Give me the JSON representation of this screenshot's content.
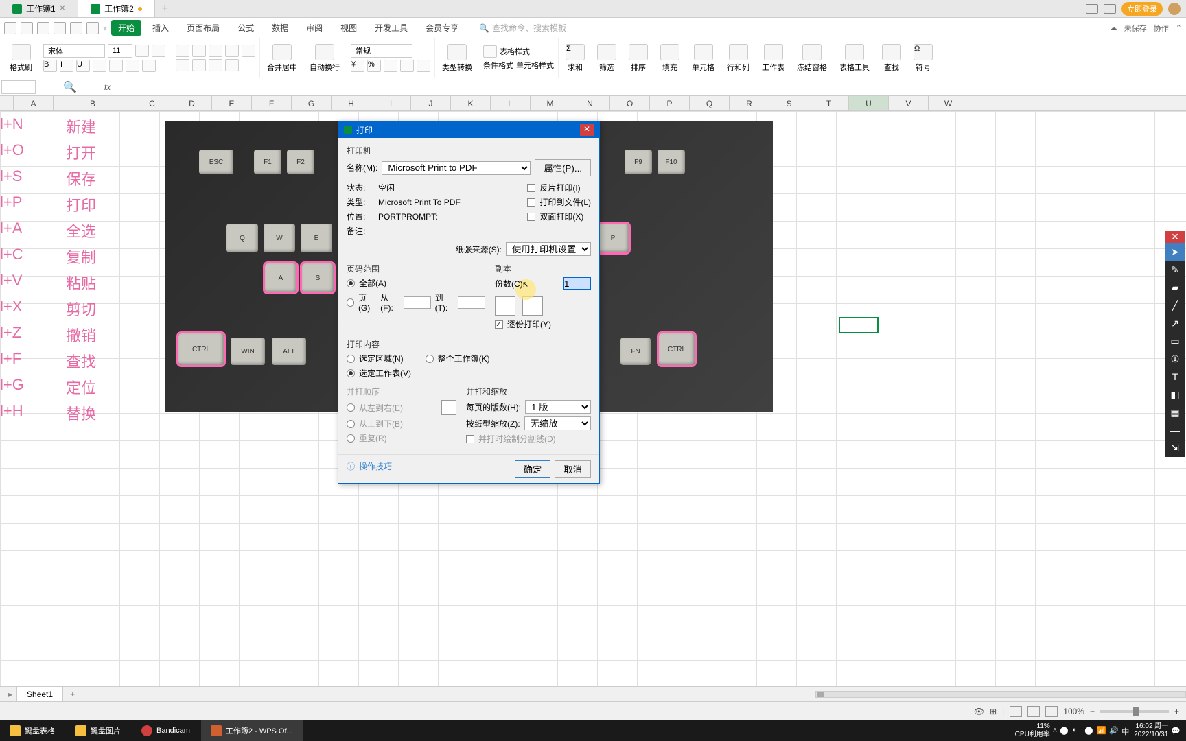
{
  "tabs": {
    "t1": "工作簿1",
    "t2": "工作簿2"
  },
  "login": "立即登录",
  "menu": {
    "start": "开始",
    "insert": "插入",
    "layout": "页面布局",
    "formula": "公式",
    "data": "数据",
    "review": "审阅",
    "view": "视图",
    "dev": "开发工具",
    "member": "会员专享",
    "search_ph": "查找命令、搜索模板"
  },
  "topright": {
    "unsaved": "未保存",
    "collab": "协作"
  },
  "ribbon": {
    "paste": "格式刷",
    "font": "宋体",
    "size": "11",
    "merge": "合并居中",
    "wrap": "自动换行",
    "numfmt": "常规",
    "type": "类型转换",
    "cond": "条件格式",
    "cellstyle": "单元格样式",
    "tablestyle": "表格样式",
    "sum": "求和",
    "filter": "筛选",
    "sort": "排序",
    "fill": "填充",
    "cell": "单元格",
    "rowcol": "行和列",
    "sheet": "工作表",
    "freeze": "冻结窗格",
    "tabletool": "表格工具",
    "find": "查找",
    "symbol": "符号"
  },
  "cells": {
    "a1": "l+N",
    "b1": "新建",
    "a2": "l+O",
    "b2": "打开",
    "a3": "l+S",
    "b3": "保存",
    "a4": "l+P",
    "b4": "打印",
    "a5": "l+A",
    "b5": "全选",
    "a6": "l+C",
    "b6": "复制",
    "a7": "l+V",
    "b7": "粘贴",
    "a8": "l+X",
    "b8": "剪切",
    "a9": "l+Z",
    "b9": "撤销",
    "a10": "l+F",
    "b10": "查找",
    "a11": "l+G",
    "b11": "定位",
    "a12": "l+H",
    "b12": "替换"
  },
  "cols": [
    "A",
    "B",
    "C",
    "D",
    "E",
    "F",
    "G",
    "H",
    "I",
    "J",
    "K",
    "L",
    "M",
    "N",
    "O",
    "P",
    "Q",
    "R",
    "S",
    "T",
    "U",
    "V",
    "W"
  ],
  "dialog": {
    "title": "打印",
    "printer_sect": "打印机",
    "name": "名称(M):",
    "name_val": "Microsoft Print to PDF",
    "props": "属性(P)...",
    "status": "状态:",
    "status_val": "空闲",
    "type": "类型:",
    "type_val": "Microsoft Print To PDF",
    "loc": "位置:",
    "loc_val": "PORTPROMPT:",
    "remark": "备注:",
    "reverse": "反片打印(I)",
    "tofile": "打印到文件(L)",
    "duplex": "双面打印(X)",
    "source": "纸张来源(S):",
    "source_val": "使用打印机设置",
    "range_sect": "页码范围",
    "all": "全部(A)",
    "page": "页(G)",
    "from": "从(F):",
    "to": "到(T):",
    "copy_sect": "副本",
    "copies": "份数(C):",
    "copies_val": "1",
    "collate": "逐份打印(Y)",
    "content_sect": "打印内容",
    "sel": "选定区域(N)",
    "whole": "整个工作簿(K)",
    "selsheet": "选定工作表(V)",
    "order_sect": "并打顺序",
    "ltr": "从左到右(E)",
    "ttb": "从上到下(B)",
    "repeat": "重复(R)",
    "scale_sect": "并打和缩放",
    "perpage": "每页的版数(H):",
    "perpage_val": "1 版",
    "zoom": "按纸型缩放(Z):",
    "zoom_val": "无缩放",
    "drawline": "并打时绘制分割线(D)",
    "tips": "操作技巧",
    "ok": "确定",
    "cancel": "取消"
  },
  "sheet": "Sheet1",
  "zoom": "100%",
  "taskbar": {
    "i1": "键盘表格",
    "i2": "键盘图片",
    "i3": "Bandicam",
    "i4": "工作簿2 - WPS Of..."
  },
  "tray": {
    "pct": "11%",
    "cpu": "CPU利用率",
    "time": "16:02",
    "date": "2022/10/31",
    "day": "周一"
  }
}
